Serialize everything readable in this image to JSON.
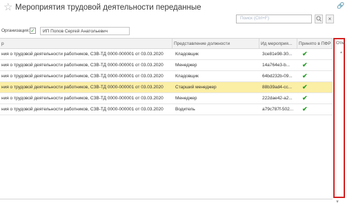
{
  "window": {
    "title": "Мероприятия трудовой деятельности переданные"
  },
  "search": {
    "placeholder": "Поиск (Ctrl+F)"
  },
  "filter": {
    "label": "Организация:",
    "value": "ИП Попов Сергей Анатольевич",
    "checked": true
  },
  "table": {
    "columns": [
      "р",
      "Представление должности",
      "Ид мероприя...",
      "Принято в ПФР",
      "Отм"
    ],
    "rows": [
      {
        "doc": "ния о трудовой деятельности работников, СЗВ-ТД 0000-000001 от 03.03.2020",
        "position": "Кладовщик",
        "id": "3ce81e98-30...",
        "accepted": true
      },
      {
        "doc": "ния о трудовой деятельности работников, СЗВ-ТД 0000-000001 от 03.03.2020",
        "position": "Менеджер",
        "id": "14a764e3-b...",
        "accepted": true
      },
      {
        "doc": "ния о трудовой деятельности работников, СЗВ-ТД 0000-000001 от 03.03.2020",
        "position": "Кладовщик",
        "id": "64bd232b-09...",
        "accepted": true
      },
      {
        "doc": "ния о трудовой деятельности работников, СЗВ-ТД 0000-000001 от 03.03.2020",
        "position": "Старший менеджер",
        "id": "88b39ad4-cc...",
        "accepted": true,
        "selected": true
      },
      {
        "doc": "ния о трудовой деятельности работников, СЗВ-ТД 0000-000001 от 03.03.2020",
        "position": "Менеджер",
        "id": "222dae42-a2...",
        "accepted": true
      },
      {
        "doc": "ния о трудовой деятельности работников, СЗВ-ТД 0000-000001 от 03.03.2020",
        "position": "Водитель",
        "id": "a79c787f-502...",
        "accepted": true
      }
    ]
  },
  "colors": {
    "selected_row": "#fbeea5",
    "check": "#23a023",
    "highlight_box": "#d52222"
  }
}
